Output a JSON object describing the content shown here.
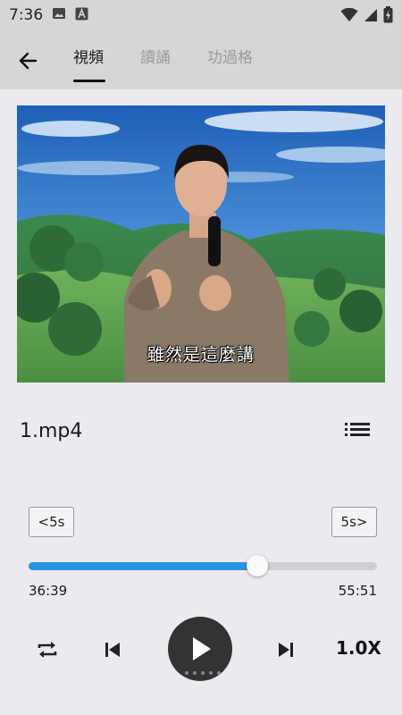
{
  "status_bar": {
    "time": "7:36",
    "icons": [
      "image-icon",
      "a-icon",
      "wifi-icon",
      "signal-icon",
      "battery-charging-icon"
    ]
  },
  "app_bar": {
    "back_icon": "arrow-left-icon",
    "tabs": [
      {
        "label": "視頻",
        "active": true
      },
      {
        "label": "讀誦",
        "active": false
      },
      {
        "label": "功過格",
        "active": false
      }
    ]
  },
  "video": {
    "subtitle": "雖然是這麼講"
  },
  "player": {
    "file_name": "1.mp4",
    "playlist_icon": "playlist-icon",
    "rewind_label": "<5s",
    "forward_label": "5s>",
    "current_time": "36:39",
    "total_time": "55:51",
    "progress_fraction": 0.656,
    "speed_label": "1.0X",
    "accent_color": "#2a93e0"
  }
}
